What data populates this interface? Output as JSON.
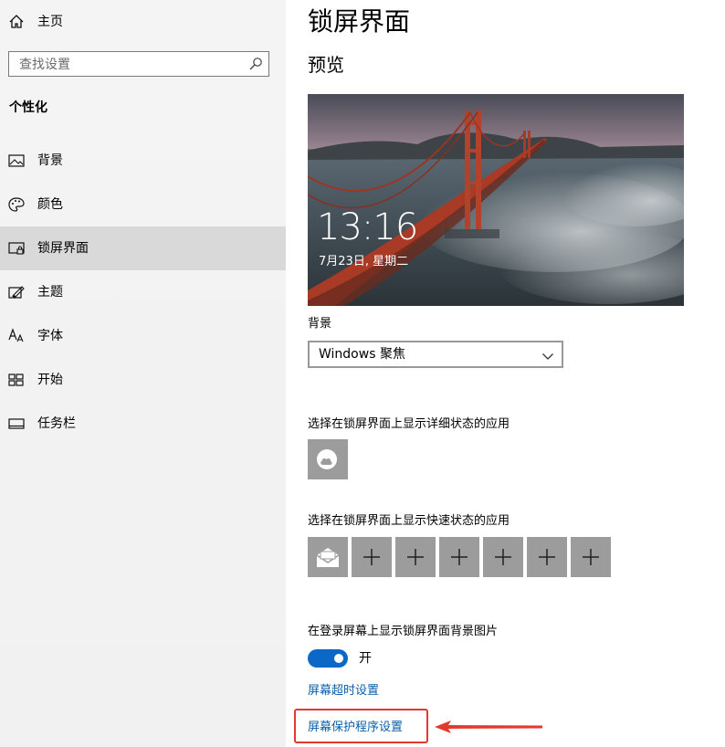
{
  "sidebar": {
    "home_label": "主页",
    "search_placeholder": "查找设置",
    "section_title": "个性化",
    "items": [
      {
        "label": "背景",
        "icon": "picture-icon"
      },
      {
        "label": "颜色",
        "icon": "palette-icon"
      },
      {
        "label": "锁屏界面",
        "icon": "lock-screen-icon",
        "active": true
      },
      {
        "label": "主题",
        "icon": "theme-brush-icon"
      },
      {
        "label": "字体",
        "icon": "font-icon"
      },
      {
        "label": "开始",
        "icon": "start-grid-icon"
      },
      {
        "label": "任务栏",
        "icon": "taskbar-icon"
      }
    ]
  },
  "main": {
    "title": "锁屏界面",
    "preview_heading": "预览",
    "preview": {
      "time": "13:16",
      "date": "7月23日, 星期二"
    },
    "background_label": "背景",
    "background_value": "Windows 聚焦",
    "detailed_status_label": "选择在锁屏界面上显示详细状态的应用",
    "quick_status_label": "选择在锁屏界面上显示快速状态的应用",
    "quick_status_slots": [
      "mail",
      "+",
      "+",
      "+",
      "+",
      "+",
      "+"
    ],
    "signin_bg_label": "在登录屏幕上显示锁屏界面背景图片",
    "signin_bg_toggle": "开",
    "screen_timeout_link": "屏幕超时设置",
    "screensaver_link": "屏幕保护程序设置"
  },
  "colors": {
    "accent": "#0b68c7",
    "link": "#0b5ea8",
    "annotation": "#e23a30",
    "tile": "#9c9c9c"
  }
}
